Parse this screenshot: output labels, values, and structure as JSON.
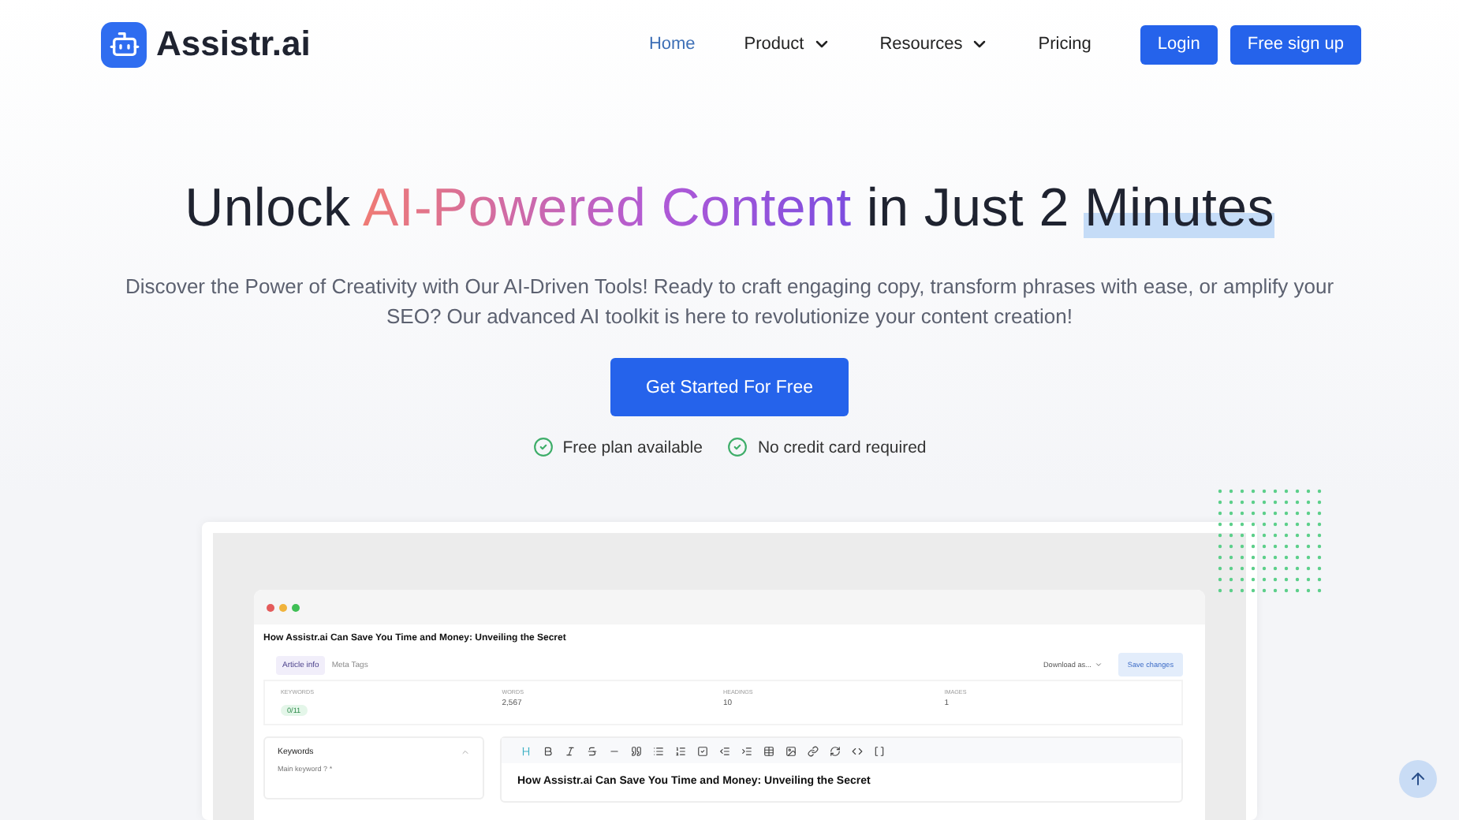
{
  "brand": {
    "name": "Assistr.ai"
  },
  "nav": [
    {
      "label": "Home",
      "selected": true,
      "dropdown": false
    },
    {
      "label": "Product",
      "selected": false,
      "dropdown": true
    },
    {
      "label": "Resources",
      "selected": false,
      "dropdown": true
    },
    {
      "label": "Pricing",
      "selected": false,
      "dropdown": false
    }
  ],
  "auth_buttons": [
    {
      "label": "Login"
    },
    {
      "label": "Free sign up"
    }
  ],
  "hero": {
    "title": [
      {
        "text": "Unlock ",
        "kind": "plain"
      },
      {
        "text": "AI-Powered Content",
        "kind": "gradient"
      },
      {
        "text": " in Just 2 ",
        "kind": "plain"
      },
      {
        "text": "Minutes",
        "kind": "highlight"
      }
    ],
    "subtitle": "Discover the Power of Creativity with Our AI-Driven Tools! Ready to craft engaging copy, transform phrases with ease, or amplify your SEO? Our advanced AI toolkit is here to revolutionize your content creation!",
    "cta": "Get Started For Free",
    "perks": [
      "Free plan available",
      "No credit card required"
    ]
  },
  "editor": {
    "title": "How Assistr.ai Can Save You Time and Money: Unveiling the Secret",
    "tabs": [
      {
        "label": "Article info",
        "selected": true
      },
      {
        "label": "Meta Tags",
        "selected": false
      }
    ],
    "download": "Download as...",
    "save": "Save changes",
    "stats": [
      {
        "label": "KEYWORDS",
        "value": "0/11",
        "kind": "badge"
      },
      {
        "label": "WORDS",
        "value": "2,567",
        "kind": "plain"
      },
      {
        "label": "HEADINGS",
        "value": "10",
        "kind": "plain"
      },
      {
        "label": "IMAGES",
        "value": "1",
        "kind": "plain"
      }
    ],
    "keywords_panel": {
      "title": "Keywords",
      "field_label": "Main keyword",
      "help": "?",
      "required": "*"
    },
    "toolbar": [
      {
        "active": true
      },
      {
        "active": false
      },
      {
        "active": false
      },
      {
        "active": false
      },
      {
        "active": false
      },
      {
        "active": false
      },
      {
        "active": false
      },
      {
        "active": false
      },
      {
        "active": false
      },
      {
        "active": false
      },
      {
        "active": false
      },
      {
        "active": false
      },
      {
        "active": false
      },
      {
        "active": false
      },
      {
        "active": false
      },
      {
        "active": false
      },
      {
        "active": false
      }
    ],
    "heading": "How Assistr.ai Can Save You Time and Money: Unveiling the Secret"
  }
}
